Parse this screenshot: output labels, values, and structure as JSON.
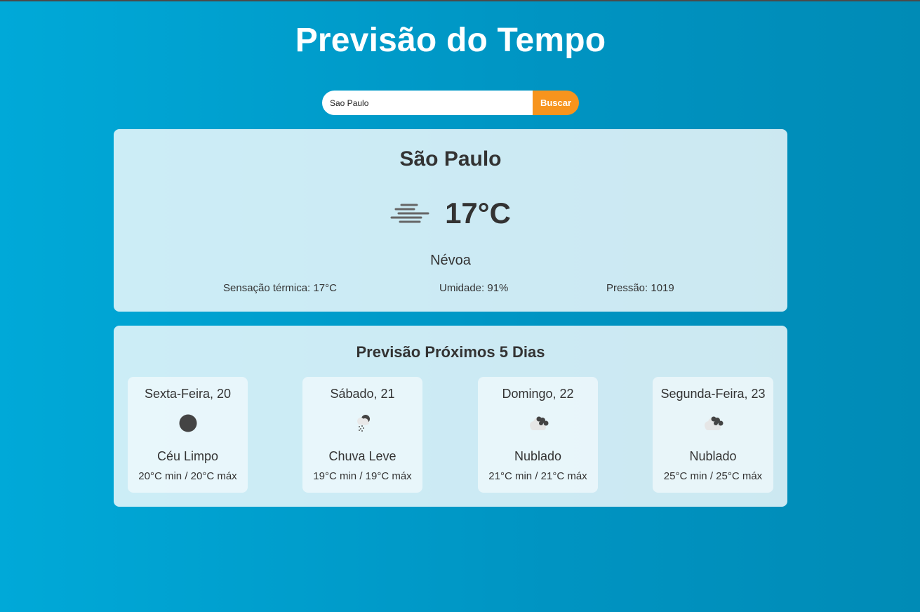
{
  "header": {
    "title": "Previsão do Tempo"
  },
  "search": {
    "value": "Sao Paulo",
    "button_label": "Buscar"
  },
  "current": {
    "city": "São Paulo",
    "icon": "mist-icon",
    "temperature": "17°C",
    "description": "Névoa",
    "feels_like": "Sensação térmica: 17°C",
    "humidity": "Umidade: 91%",
    "pressure": "Pressão: 1019"
  },
  "forecast": {
    "title": "Previsão Próximos 5 Dias",
    "days": [
      {
        "name": "Sexta-Feira, 20",
        "icon": "clear-sky-icon",
        "description": "Céu Limpo",
        "range": "20°C min / 20°C máx"
      },
      {
        "name": "Sábado, 21",
        "icon": "light-rain-icon",
        "description": "Chuva Leve",
        "range": "19°C min / 19°C máx"
      },
      {
        "name": "Domingo, 22",
        "icon": "cloudy-icon",
        "description": "Nublado",
        "range": "21°C min / 21°C máx"
      },
      {
        "name": "Segunda-Feira, 23",
        "icon": "cloudy-icon",
        "description": "Nublado",
        "range": "25°C min / 25°C máx"
      }
    ]
  },
  "colors": {
    "background_start": "#00a9d8",
    "background_end": "#008bb6",
    "button": "#f7941d",
    "card": "#cdeaf2",
    "text": "#333333"
  }
}
